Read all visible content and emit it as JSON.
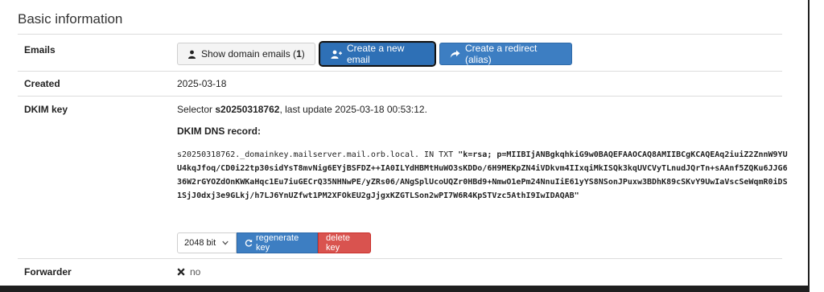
{
  "section": {
    "title": "Basic information"
  },
  "emails": {
    "label": "Emails",
    "show_domain_prefix": "Show domain emails (",
    "show_domain_count": "1",
    "show_domain_suffix": ")",
    "create_email_label": "Create a new email",
    "create_redirect_label": "Create a redirect (alias)"
  },
  "created": {
    "label": "Created",
    "value": "2025-03-18"
  },
  "dkim": {
    "label": "DKIM key",
    "selector_prefix": "Selector ",
    "selector": "s20250318762",
    "last_update_text": ", last update 2025-03-18 00:53:12.",
    "dns_record_heading": "DKIM DNS record:",
    "record_prefix": "s20250318762._domainkey.mailserver.mail.orb.local. IN TXT ",
    "record_value": "\"k=rsa; p=MIIBIjANBgkqhkiG9w0BAQEFAAOCAQ8AMIIBCgKCAQEAq2iuiZ2ZnnW9YUU4kqJfoq/CD0i22tp30sidYsT8mvNig6EYjBSFDZ++IA0ILYdHBMtHuWO3sKDDo/6H9MEKpZN4iVDkvm4IIxqiMkISQk3kqUVCVyTLnudJQrTn+sAAnf5ZQKu6JJG636W2rGYOZdOnKWKaHqc1Eu7iuGECrQ35NHNwPE/yZRs06/ANgSplUcoUQZr0HBd9+NmwO1ePm24NnuIiE61yYS8NSonJPuxw3BDhK89cSKvY9UwIaVscSeWqmR0iDS1SjJ0dxj3e9GLkj/h7LJ6YnUZfwt1PM2XFOkEU2gJjgxKZGTLSon2wPI7W6R4KpSTVzc5AthI9IwIDAQAB\"",
    "key_size": "2048 bit",
    "regenerate_label": "regenerate key",
    "delete_label": "delete key"
  },
  "forwarder": {
    "label": "Forwarder",
    "value": "no"
  },
  "colors": {
    "primary": "#3d7ec2",
    "danger": "#d9534f",
    "border": "#dcdcdc"
  },
  "icons": [
    "user-icon",
    "user-plus-icon",
    "share-icon",
    "refresh-icon",
    "close-icon",
    "chevron-down-icon"
  ]
}
